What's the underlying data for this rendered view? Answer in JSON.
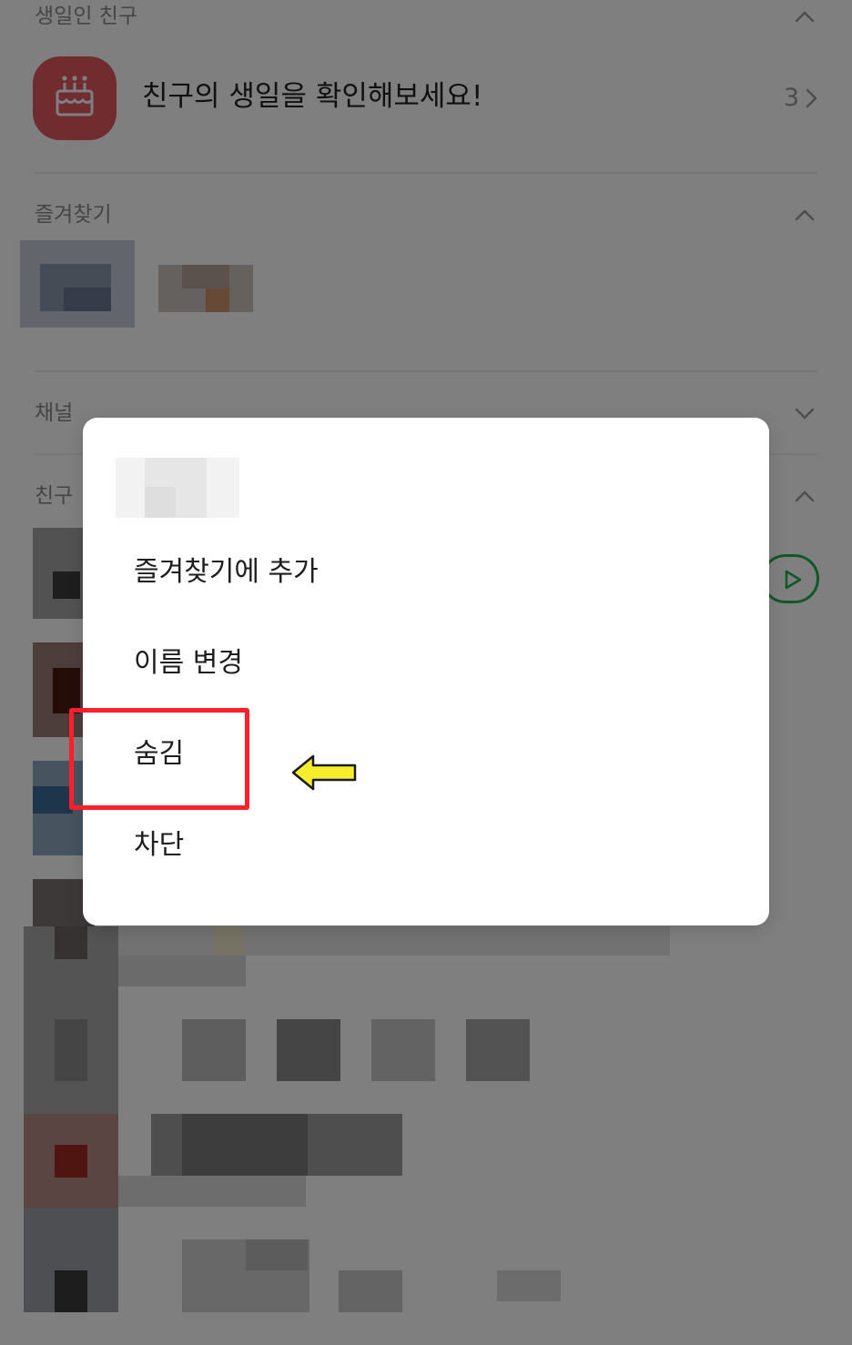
{
  "sections": {
    "birthday": {
      "title": "생일인 친구",
      "toggle_icon": "chevron-up-icon"
    },
    "favorites": {
      "title": "즐겨찾기",
      "toggle_icon": "chevron-up-icon"
    },
    "channel": {
      "title": "채널",
      "toggle_icon": "chevron-down-icon"
    },
    "friends": {
      "title": "친구",
      "toggle_icon": "chevron-up-icon"
    }
  },
  "birthday_row": {
    "text": "친구의 생일을 확인해보세요!",
    "count": "3",
    "icon": "birthday-cake-icon",
    "icon_color": "#e2585f"
  },
  "friend_action_icon": "play-icon",
  "friend_action_color": "#21b04b",
  "context_menu": {
    "items": [
      {
        "label": "즐겨찾기에 추가"
      },
      {
        "label": "이름 변경"
      },
      {
        "label": "숨김"
      },
      {
        "label": "차단"
      }
    ]
  },
  "annotation": {
    "highlight_color": "#ff1e2a",
    "arrow_color": "#f6ee2c",
    "highlighted_item": "숨김"
  }
}
